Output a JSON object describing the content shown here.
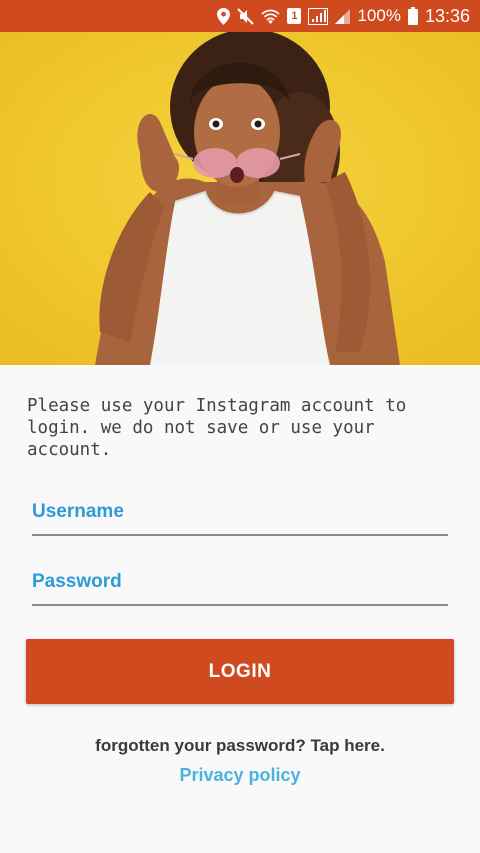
{
  "status_bar": {
    "battery": "100%",
    "time": "13:36",
    "sim_slot": "1",
    "icons": [
      "location-icon",
      "mute-icon",
      "wifi-icon",
      "sim-icon",
      "signal-icon",
      "signal-2-icon",
      "battery-icon"
    ]
  },
  "hero": {
    "image": "woman-with-sunglasses-photo",
    "background_color": "#f0c62a"
  },
  "info": {
    "text": "Please use your Instagram account to login. we do not save or use your account."
  },
  "form": {
    "username_placeholder": "Username",
    "password_placeholder": "Password",
    "login_label": "LOGIN"
  },
  "links": {
    "forgot": "forgotten your password? Tap here.",
    "privacy": "Privacy policy"
  },
  "colors": {
    "accent": "#cf4a1e",
    "input_label": "#2e9bd6",
    "link": "#48b4de"
  }
}
